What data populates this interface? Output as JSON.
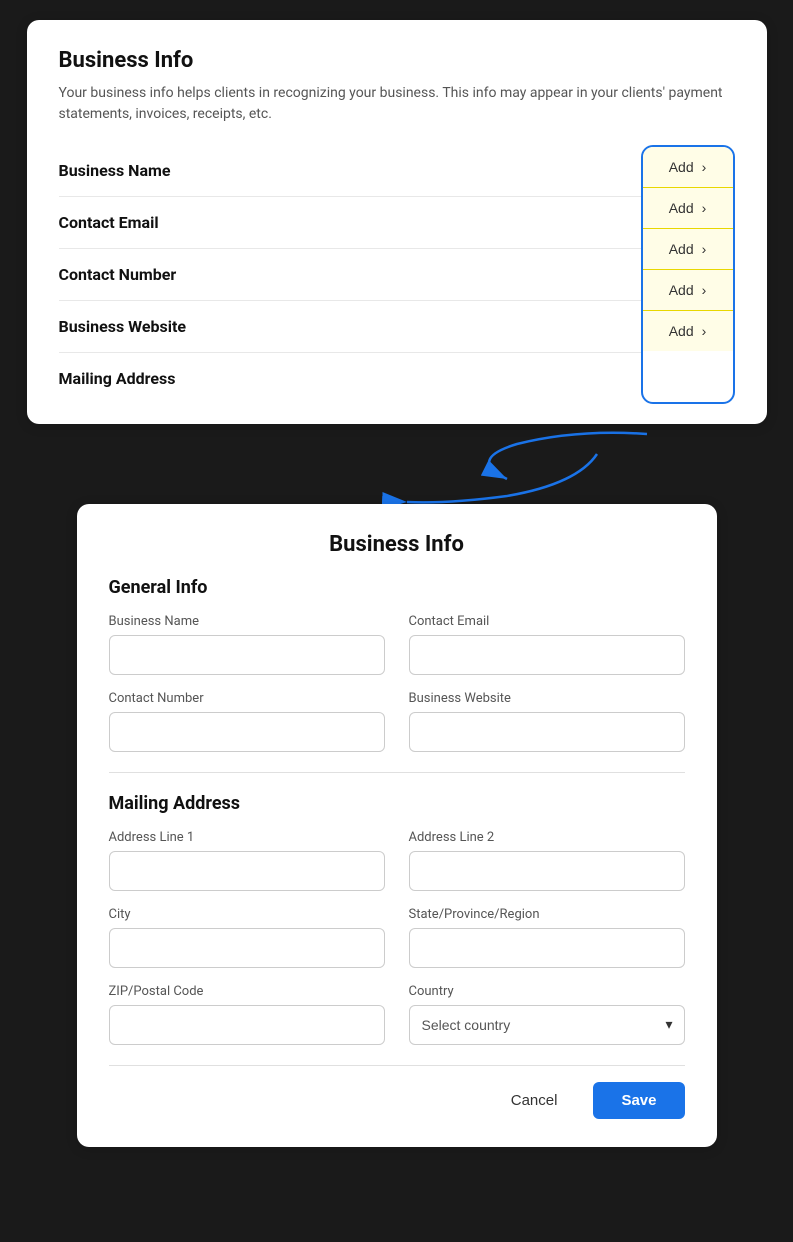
{
  "top_card": {
    "title": "Business Info",
    "description": "Your business info helps clients in recognizing your business. This info may appear in your clients' payment statements, invoices, receipts, etc.",
    "rows": [
      {
        "label": "Business Name",
        "button": "Add",
        "id": "business-name"
      },
      {
        "label": "Contact Email",
        "button": "Add",
        "id": "contact-email"
      },
      {
        "label": "Contact Number",
        "button": "Add",
        "id": "contact-number"
      },
      {
        "label": "Business Website",
        "button": "Add",
        "id": "business-website"
      },
      {
        "label": "Mailing Address",
        "button": "Add",
        "id": "mailing-address"
      }
    ]
  },
  "bottom_card": {
    "title": "Business Info",
    "general_info": {
      "section_title": "General Info",
      "fields": [
        {
          "label": "Business Name",
          "placeholder": "",
          "id": "biz-name-input"
        },
        {
          "label": "Contact Email",
          "placeholder": "",
          "id": "contact-email-input"
        },
        {
          "label": "Contact Number",
          "placeholder": "",
          "id": "contact-number-input"
        },
        {
          "label": "Business Website",
          "placeholder": "",
          "id": "biz-website-input"
        }
      ]
    },
    "mailing_address": {
      "section_title": "Mailing Address",
      "fields": [
        {
          "label": "Address Line 1",
          "placeholder": "",
          "id": "addr1-input"
        },
        {
          "label": "Address Line 2",
          "placeholder": "",
          "id": "addr2-input"
        },
        {
          "label": "City",
          "placeholder": "",
          "id": "city-input"
        },
        {
          "label": "State/Province/Region",
          "placeholder": "",
          "id": "state-input"
        },
        {
          "label": "ZIP/Postal Code",
          "placeholder": "",
          "id": "zip-input"
        },
        {
          "label": "Country",
          "placeholder": "Select country",
          "id": "country-select"
        }
      ]
    },
    "actions": {
      "cancel": "Cancel",
      "save": "Save"
    }
  }
}
